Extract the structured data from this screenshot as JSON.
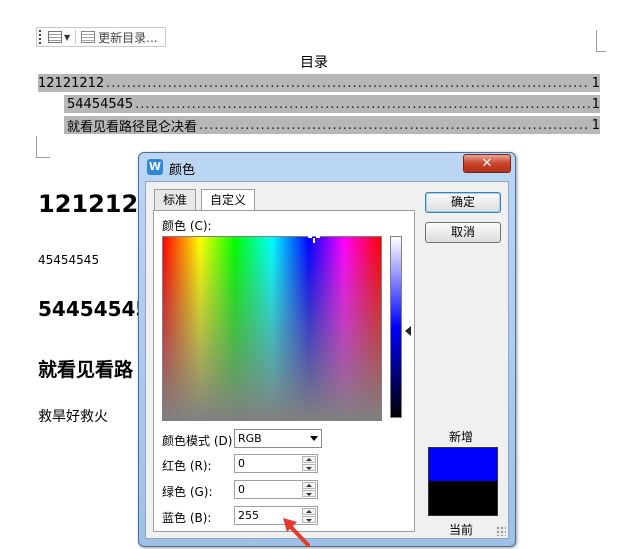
{
  "toolbar": {
    "update_toc_label": "更新目录..."
  },
  "toc": {
    "title": "目录",
    "entries": [
      {
        "text": "12121212",
        "dots": "................................................................................................................................................................................................................................",
        "page": "1"
      },
      {
        "text": "54454545",
        "dots": "................................................................................................................................................................................................................................",
        "page": "1"
      },
      {
        "text": "就看见看路径昆仑决看",
        "dots": "................................................................................................................................................................................................................................",
        "page": "1"
      }
    ]
  },
  "document": {
    "heading1": "1212121",
    "para1": "45454545",
    "heading2": "54454545",
    "heading3": "就看见看路",
    "para2": "救旱好救火"
  },
  "dialog": {
    "app_icon_glyph": "W",
    "title": "颜色",
    "close_glyph": "✕",
    "tabs": [
      "标准",
      "自定义"
    ],
    "active_tab": "自定义",
    "colors_label": "颜色 (C):",
    "color_mode_label": "颜色模式 (D)",
    "color_mode_value": "RGB",
    "red_label": "红色 (R):",
    "green_label": "绿色 (G):",
    "blue_label": "蓝色 (B):",
    "red_value": "0",
    "green_value": "0",
    "blue_value": "255",
    "ok_label": "确定",
    "cancel_label": "取消",
    "new_label": "新增",
    "current_label": "当前",
    "new_color": "#0000ff",
    "current_color": "#000000"
  },
  "annotation": {
    "arrow_color": "#e8382c"
  }
}
